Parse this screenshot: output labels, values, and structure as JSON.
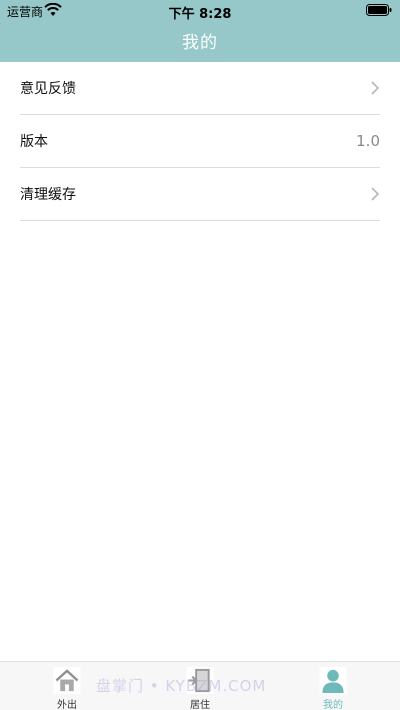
{
  "status_bar": {
    "carrier": "运营商",
    "time": "下午 8:28"
  },
  "nav": {
    "title": "我的"
  },
  "settings": {
    "items": [
      {
        "label": "意见反馈",
        "icon": "chevron-right-icon"
      },
      {
        "label": "版本",
        "value": "1.0"
      },
      {
        "label": "清理缓存",
        "icon": "chevron-right-icon"
      }
    ]
  },
  "tab_bar": {
    "tabs": [
      {
        "label": "外出",
        "icon": "house-icon"
      },
      {
        "label": "居住",
        "icon": "door-icon"
      },
      {
        "label": "我的",
        "icon": "person-icon",
        "active": true
      }
    ]
  },
  "watermark": {
    "text": "盘掌门 • KYBZM.COM"
  },
  "colors": {
    "header": "#96c8c9",
    "active_tab": "#6fb9bb",
    "chevron": "#b8b8b8"
  }
}
